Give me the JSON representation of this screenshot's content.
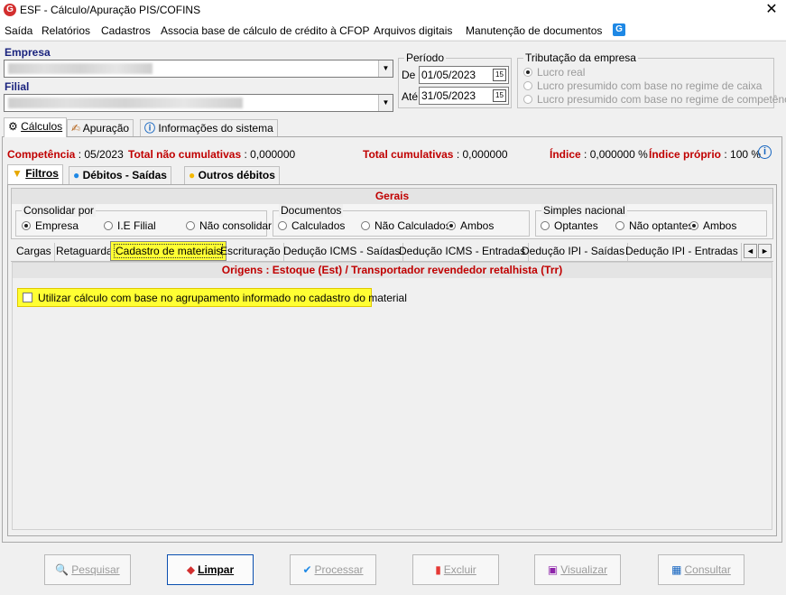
{
  "window": {
    "title": "ESF - Cálculo/Apuração PIS/COFINS",
    "app_icon": "G",
    "close_glyph": "✕"
  },
  "menu": {
    "items": [
      "Saída",
      "Relatórios",
      "Cadastros",
      "Associa base de cálculo de crédito à CFOP",
      "Arquivos digitais",
      "Manutenção de documentos"
    ],
    "help_icon": "G"
  },
  "empresa": {
    "label": "Empresa",
    "value": ""
  },
  "filial": {
    "label": "Filial",
    "value": ""
  },
  "periodo": {
    "title": "Período",
    "de_label": "De",
    "de_value": "01/05/2023",
    "ate_label": "Até",
    "ate_value": "31/05/2023",
    "cal_label": "15"
  },
  "tributacao": {
    "title": "Tributação da empresa",
    "options": [
      "Lucro real",
      "Lucro presumido com base no regime de caixa",
      "Lucro presumido com base no regime de competência"
    ]
  },
  "main_tabs": [
    "Cálculos",
    "Apuração",
    "Informações do sistema"
  ],
  "infobar": {
    "competencia_label": "Competência",
    "competencia_value": ": 05/2023",
    "total_nao_label": "Total não cumulativas",
    "total_nao_value": ": 0,000000",
    "total_cum_label": "Total cumulativas",
    "total_cum_value": ": 0,000000",
    "indice_label": "Índice",
    "indice_value": ": 0,000000 %",
    "indice_proprio_label": "Índice próprio",
    "indice_proprio_value": ": 100 %"
  },
  "inner_tabs": [
    "Filtros",
    "Débitos - Saídas",
    "Outros débitos"
  ],
  "gerais": {
    "title": "Gerais",
    "consolidar": {
      "title": "Consolidar por",
      "options": [
        "Empresa",
        "I.E Filial",
        "Não consolidar"
      ]
    },
    "documentos": {
      "title": "Documentos",
      "options": [
        "Calculados",
        "Não Calculados",
        "Ambos"
      ]
    },
    "simples": {
      "title": "Simples nacional",
      "options": [
        "Optantes",
        "Não optantes",
        "Ambos"
      ]
    }
  },
  "sub_tabs": [
    "Cargas",
    "Retaguarda",
    "Cadastro de materiais",
    "Escrituração",
    "Dedução ICMS - Saídas",
    "Dedução ICMS - Entradas",
    "Dedução IPI - Saídas",
    "Dedução IPI - Entradas"
  ],
  "scroll_glyphs": {
    "left": "◄",
    "right": "►"
  },
  "origens": {
    "title": "Origens : Estoque (Est) / Transportador revendedor retalhista (Trr)"
  },
  "checkbox_label": "Utilizar cálculo com base no agrupamento informado no cadastro do material",
  "buttons": {
    "pesquisar": "Pesquisar",
    "limpar": "Limpar",
    "processar": "Processar",
    "excluir": "Excluir",
    "visualizar": "Visualizar",
    "consultar": "Consultar"
  },
  "colors": {
    "accent_red": "#c00000",
    "label_blue": "#1a237e",
    "highlight_yellow": "#ffff33"
  }
}
